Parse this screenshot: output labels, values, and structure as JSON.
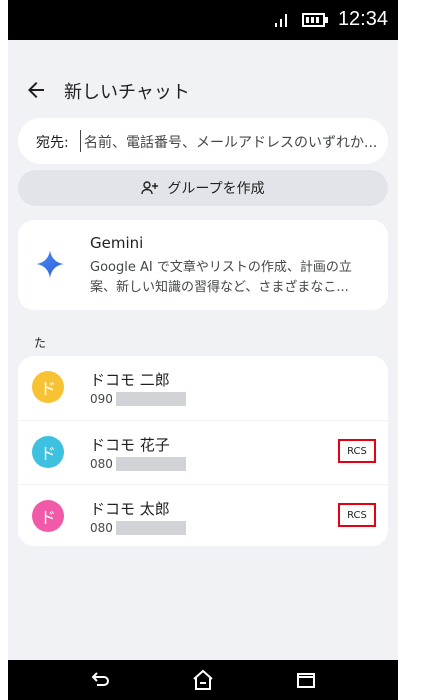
{
  "status": {
    "time": "12:34"
  },
  "topbar": {
    "title": "新しいチャット"
  },
  "to_field": {
    "label": "宛先:",
    "placeholder": "名前、電話番号、メールアドレスのいずれか..."
  },
  "group_button": {
    "label": "グループを作成"
  },
  "gemini": {
    "title": "Gemini",
    "description": "Google AI で文章やリストの作成、計画の立案、新しい知識の習得など、さまざまなこ..."
  },
  "section": {
    "header": "た"
  },
  "contacts": [
    {
      "initial": "ド",
      "name": "ドコモ 二郎",
      "phone_prefix": "090",
      "avatar_color": "#f7c234",
      "rcs": ""
    },
    {
      "initial": "ド",
      "name": "ドコモ 花子",
      "phone_prefix": "080",
      "avatar_color": "#3ec1e0",
      "rcs": "RCS"
    },
    {
      "initial": "ド",
      "name": "ドコモ 太郎",
      "phone_prefix": "080",
      "avatar_color": "#f05aa8",
      "rcs": "RCS"
    }
  ],
  "colors": {
    "highlight": "#e60012",
    "background": "#f1f2f6"
  },
  "icons": {
    "back": "arrow-left-icon",
    "group": "group-add-icon",
    "gemini": "sparkle-icon",
    "nav_back": "back-icon",
    "nav_home": "home-icon",
    "nav_recents": "recents-icon"
  }
}
